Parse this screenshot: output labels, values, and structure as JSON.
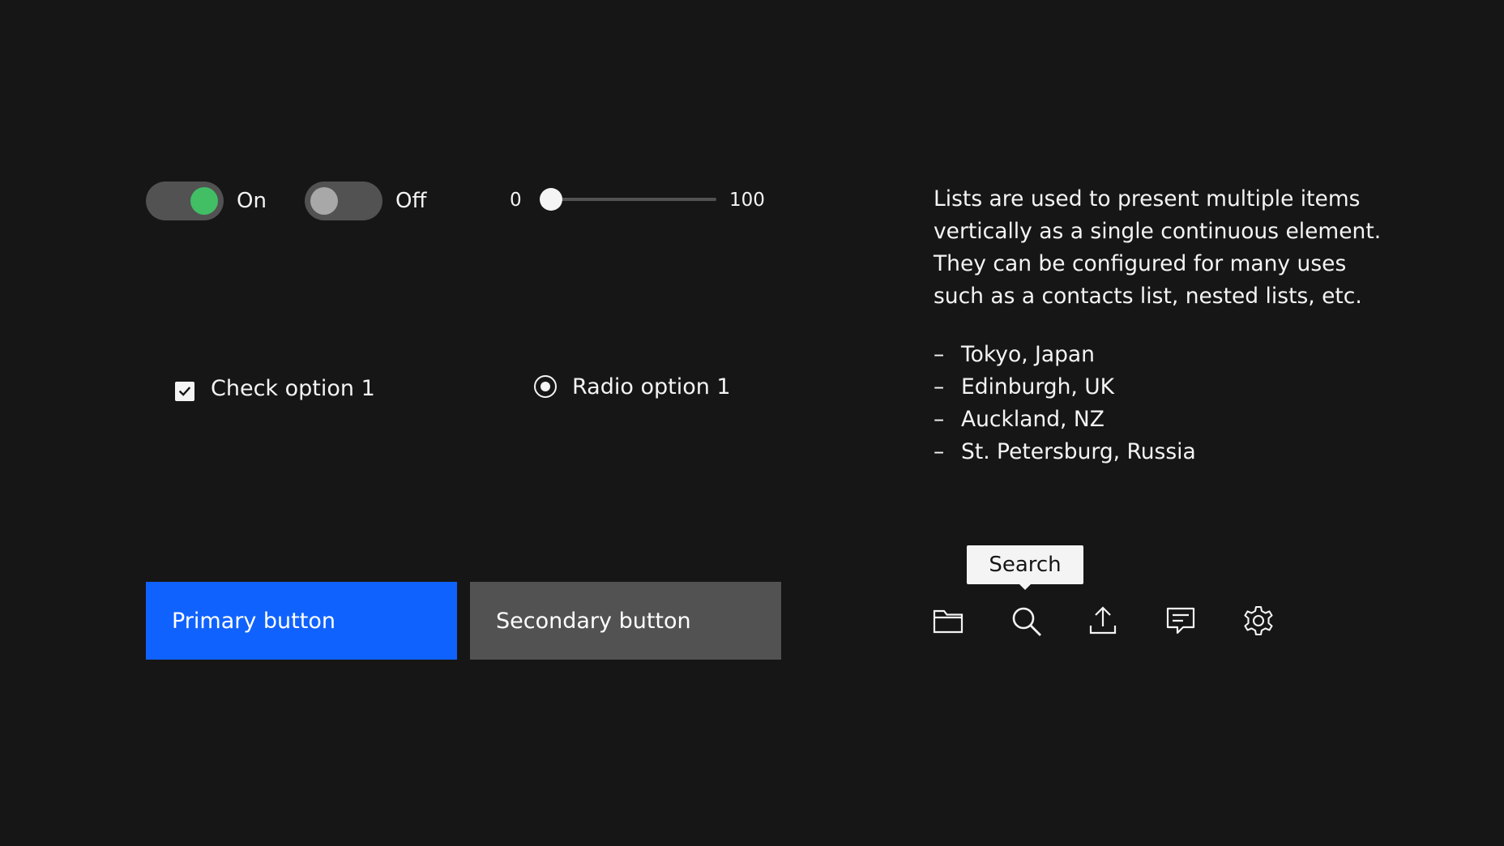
{
  "controls": {
    "toggle_on": {
      "label": "On",
      "state": "on",
      "color": "#42be65"
    },
    "toggle_off": {
      "label": "Off",
      "state": "off"
    },
    "slider": {
      "min_label": "0",
      "max_label": "100",
      "value": 0
    },
    "checkbox": {
      "label": "Check option 1",
      "checked": true
    },
    "radio": {
      "label": "Radio option 1",
      "selected": true
    }
  },
  "buttons": {
    "primary": {
      "label": "Primary button",
      "color": "#0f62fe"
    },
    "secondary": {
      "label": "Secondary button",
      "color": "#525252"
    }
  },
  "content": {
    "paragraph_lines": [
      "Lists are used to present multiple items",
      "vertically as a single continuous element.",
      "They can be configured for many uses",
      "such as a contacts list, nested lists, etc."
    ],
    "list_marker": "–",
    "list_items": [
      "Tokyo, Japan",
      "Edinburgh, UK",
      "Auckland, NZ",
      "St. Petersburg, Russia"
    ]
  },
  "toolbar": {
    "tooltip": "Search",
    "icons": [
      "folder-icon",
      "search-icon",
      "upload-icon",
      "chat-icon",
      "settings-icon"
    ]
  },
  "theme": {
    "background": "#161616",
    "text": "#f4f4f4"
  }
}
